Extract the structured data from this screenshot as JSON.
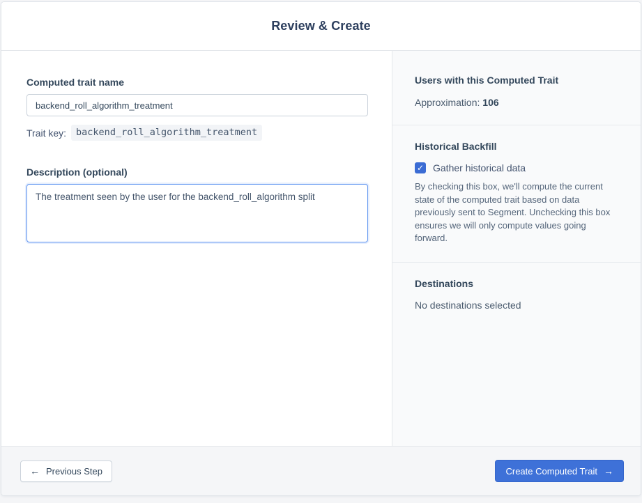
{
  "header": {
    "title": "Review & Create"
  },
  "form": {
    "name_label": "Computed trait name",
    "name_value": "backend_roll_algorithm_treatment",
    "trait_key_label": "Trait key:",
    "trait_key_value": "backend_roll_algorithm_treatment",
    "description_label": "Description (optional)",
    "description_value": "The treatment seen by the user for the backend_roll_algorithm split"
  },
  "summary": {
    "users_heading": "Users with this Computed Trait",
    "approximation_label": "Approximation:",
    "approximation_value": "106",
    "backfill_heading": "Historical Backfill",
    "backfill_checkbox_checked": "true",
    "backfill_checkmark": "✓",
    "backfill_checkbox_label": "Gather historical data",
    "backfill_help": "By checking this box, we'll compute the current state of the computed trait based on data previously sent to Segment. Unchecking this box ensures we will only compute values going forward.",
    "destinations_heading": "Destinations",
    "destinations_value": "No destinations selected"
  },
  "footer": {
    "previous_arrow": "←",
    "previous_label": "Previous Step",
    "create_label": "Create Computed Trait",
    "create_arrow": "→"
  },
  "colors": {
    "accent_blue": "#3e71d8",
    "checkbox_blue": "#3b6cd4",
    "focus_border_blue": "#5d93f0",
    "heading_navy": "#2d3f5e",
    "panel_bg": "#f9fafb",
    "footer_bg": "#f5f6f8"
  }
}
